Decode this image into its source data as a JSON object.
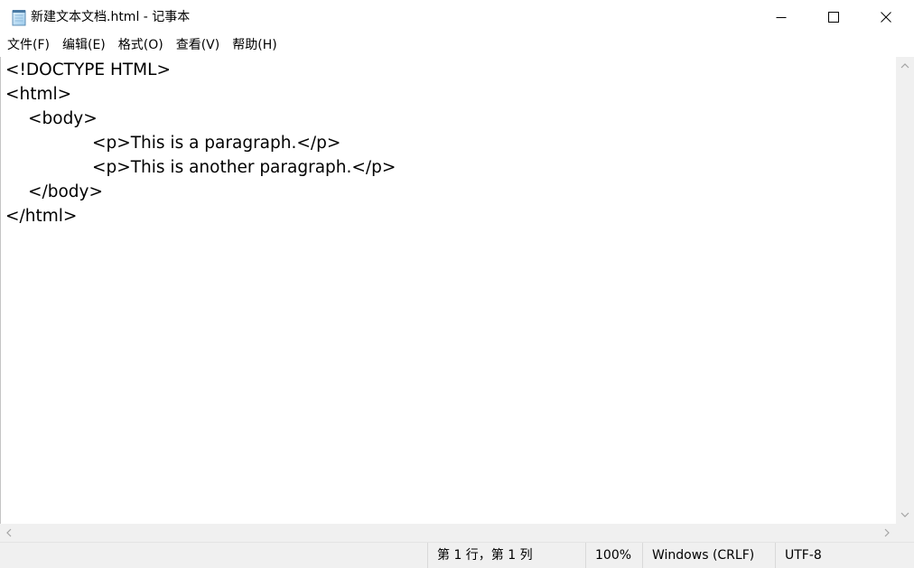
{
  "window": {
    "title": "新建文本文档.html - 记事本",
    "app_icon": "notepad-icon"
  },
  "controls": {
    "minimize_icon": "minimize-icon",
    "maximize_icon": "maximize-icon",
    "close_icon": "close-icon"
  },
  "menu": [
    {
      "label": "文件(F)"
    },
    {
      "label": "编辑(E)"
    },
    {
      "label": "格式(O)"
    },
    {
      "label": "查看(V)"
    },
    {
      "label": "帮助(H)"
    }
  ],
  "editor": {
    "lines": [
      "<!DOCTYPE HTML>",
      "<html>",
      "<body>",
      "<p>This is a paragraph.</p>",
      "<p>This is another paragraph.</p>",
      "</body>",
      "</html>"
    ]
  },
  "scrollbars": {
    "vertical": {
      "up_icon": "chevron-up-icon",
      "down_icon": "chevron-down-icon"
    },
    "horizontal": {
      "left_icon": "chevron-left-icon",
      "right_icon": "chevron-right-icon"
    }
  },
  "statusbar": {
    "position": "第 1 行，第 1 列",
    "zoom": "100%",
    "line_ending": "Windows (CRLF)",
    "encoding": "UTF-8"
  },
  "colors": {
    "chrome_background": "#f0f0f0",
    "editor_background": "#ffffff",
    "text": "#000000",
    "scroll_arrow": "#a3a3a3"
  }
}
